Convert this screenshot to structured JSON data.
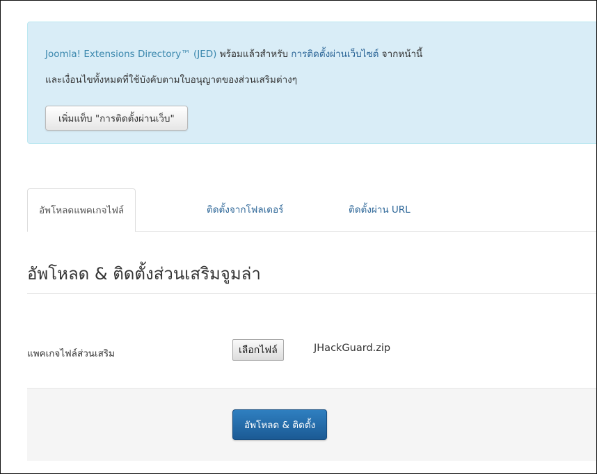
{
  "info_panel": {
    "line1_part1": "Joomla! Extensions Directory™ (JED)",
    "line1_part2": " พร้อมแล้วสำหรับ ",
    "line1_link": "การติดตั้งผ่านเว็บไซต์",
    "line1_part3": " จากหน้านี้",
    "line2": "และเงื่อนไขทั้งหมดที่ใช้บังคับตามใบอนุญาตของส่วนเสริมต่างๆ",
    "add_tab_button": "เพิ่มแท็บ \"การติดตั้งผ่านเว็บ\""
  },
  "tabs": [
    {
      "label": "อัพโหลดแพคเกจไฟล์",
      "active": true
    },
    {
      "label": "ติดตั้งจากโฟลเดอร์",
      "active": false
    },
    {
      "label": "ติดตั้งผ่าน URL",
      "active": false
    }
  ],
  "section": {
    "heading": "อัพโหลด & ติดตั้งส่วนเสริมจูมล่า",
    "field_label": "แพคเกจไฟล์ส่วนเสริม",
    "choose_file_button": "เลือกไฟล์",
    "selected_file": "JHackGuard.zip",
    "upload_button": "อัพโหลด & ติดตั้ง"
  }
}
